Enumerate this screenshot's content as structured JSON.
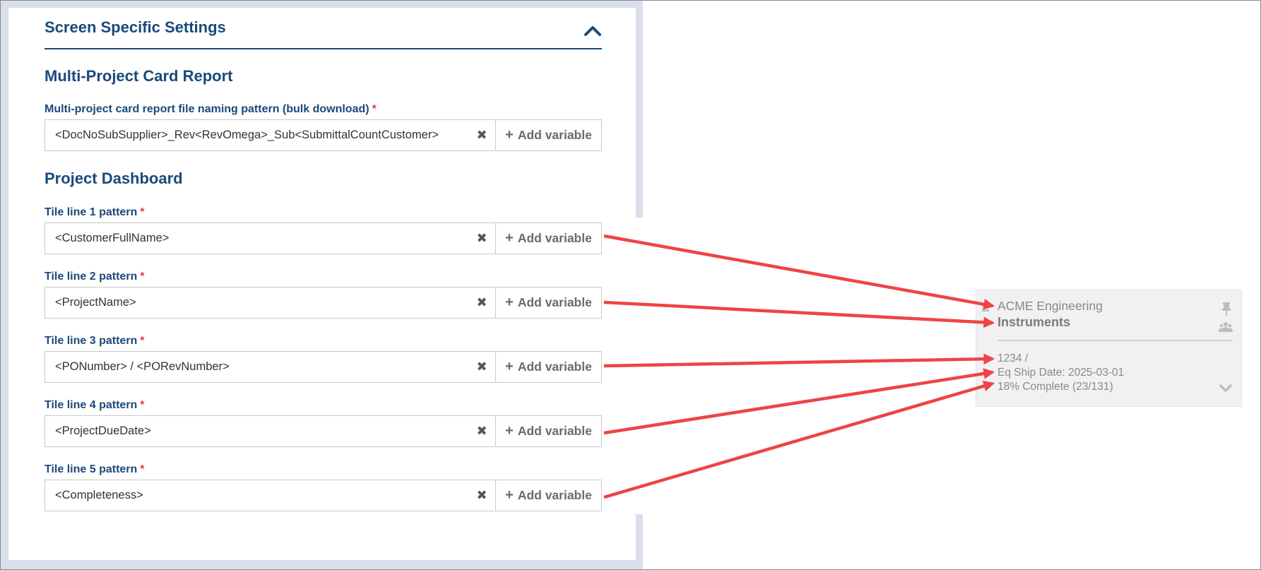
{
  "section": {
    "title": "Screen Specific Settings"
  },
  "multi_project": {
    "heading": "Multi-Project Card Report",
    "label": "Multi-project card report file naming pattern (bulk download)",
    "required_mark": "*",
    "value": "<DocNoSubSupplier>_Rev<RevOmega>_Sub<SubmittalCountCustomer>",
    "clear_glyph": "✖",
    "add_label": "Add variable"
  },
  "dashboard": {
    "heading": "Project Dashboard",
    "fields": [
      {
        "label": "Tile line 1 pattern",
        "required_mark": "*",
        "value": "<CustomerFullName>",
        "clear_glyph": "✖",
        "add_label": "Add variable"
      },
      {
        "label": "Tile line 2 pattern",
        "required_mark": "*",
        "value": "<ProjectName>",
        "clear_glyph": "✖",
        "add_label": "Add variable"
      },
      {
        "label": "Tile line 3 pattern",
        "required_mark": "*",
        "value": "<PONumber> / <PORevNumber>",
        "clear_glyph": "✖",
        "add_label": "Add variable"
      },
      {
        "label": "Tile line 4 pattern",
        "required_mark": "*",
        "value": "<ProjectDueDate>",
        "clear_glyph": "✖",
        "add_label": "Add variable"
      },
      {
        "label": "Tile line 5 pattern",
        "required_mark": "*",
        "value": "<Completeness>",
        "clear_glyph": "✖",
        "add_label": "Add variable"
      }
    ]
  },
  "tile": {
    "line1": "ACME Engineering",
    "line2": "Instruments",
    "line3": "1234 /",
    "line4": "Eq Ship Date: 2025-03-01",
    "line5": "18% Complete (23/131)",
    "icons": [
      "pin-icon",
      "people-icon",
      "chevron-down-icon"
    ]
  },
  "colors": {
    "accent": "#1a4a7a",
    "required": "#e23b3b",
    "arrow": "#ee4444",
    "tile_bg": "#f1f1f3",
    "frame_bg": "#d9e0ec"
  }
}
